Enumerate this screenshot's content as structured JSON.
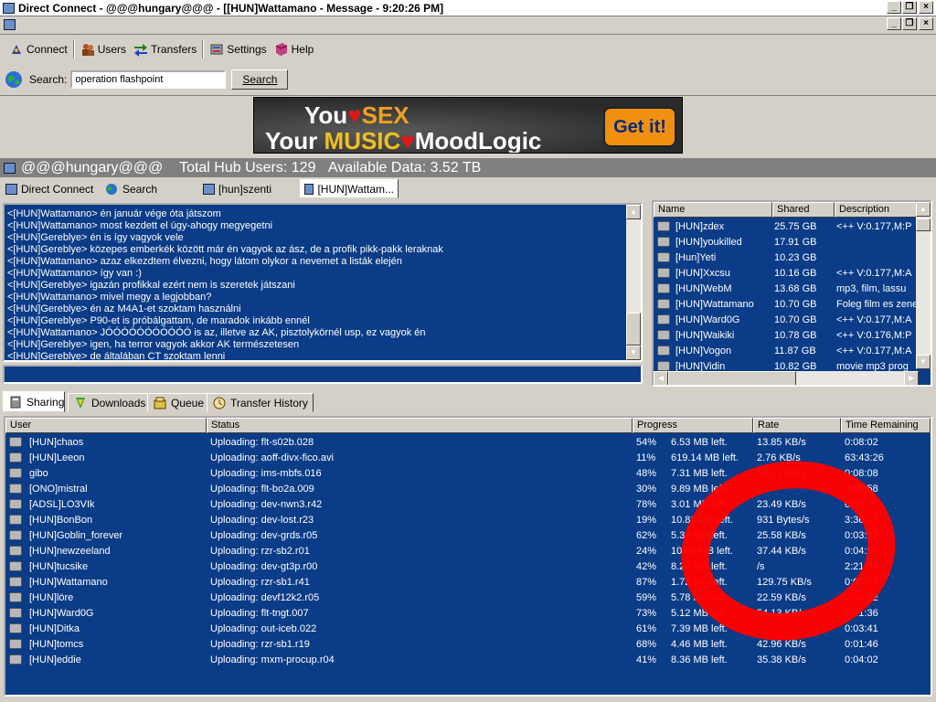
{
  "window": {
    "title": "Direct Connect - @@@hungary@@@ - [[HUN]Wattamano - Message - 9:20:26 PM]"
  },
  "toolbar": {
    "connect": "Connect",
    "users": "Users",
    "transfers": "Transfers",
    "settings": "Settings",
    "help": "Help"
  },
  "search": {
    "label": "Search:",
    "value": "operation flashpoint",
    "button": "Search"
  },
  "banner": {
    "line1_a": "You",
    "line1_b": "SEX",
    "line2_a": "Your",
    "line2_b": "MUSIC",
    "line2_c": "MoodLogic",
    "cta": "Get it!"
  },
  "hub": {
    "name": "@@@hungary@@@",
    "total_users": "Total Hub Users: 129",
    "available": "Available Data: 3.52 TB"
  },
  "tabs": [
    {
      "label": "Direct Connect"
    },
    {
      "label": "Search"
    },
    {
      "label": "[hun]szenti"
    },
    {
      "label": "[HUN]Wattam..."
    }
  ],
  "chat": [
    "<[HUN]Wattamano> én január vége óta játszom",
    "<[HUN]Wattamano> most kezdett el úgy-ahogy megyegetni",
    "<[HUN]Gereblye> én is így vagyok vele",
    "<[HUN]Gereblye> közepes emberkék között már én vagyok az ász, de a profik pikk-pakk leraknak",
    "<[HUN]Wattamano> azaz elkezdtem élvezni, hogy látom olykor a nevemet a listák elején",
    "<[HUN]Wattamano> így van :)",
    "<[HUN]Gereblye> igazán profikkal ezért nem is szeretek játszani",
    "<[HUN]Wattamano> mivel megy a legjobban?",
    "<[HUN]Gereblye> én az M4A1-et szoktam használni",
    "<[HUN]Gereblye> P90-et is próbálgattam, de maradok inkább ennél",
    "<[HUN]Wattamano> JÓÓÓÓÓÓÓÓÓÓÓ is az, illetve az AK, pisztolykörnél usp, ez vagyok én",
    "<[HUN]Gereblye> igen, ha terror vagyok akkor AK természetesen",
    "<[HUN]Gereblye> de általában CT szoktam lenni"
  ],
  "userlist": {
    "headers": [
      "Name",
      "Shared",
      "Description"
    ],
    "rows": [
      {
        "name": "[HUN]zdex",
        "shared": "25.75 GB",
        "desc": "<++ V:0.177,M:P"
      },
      {
        "name": "[HUN]youkilled",
        "shared": "17.91 GB",
        "desc": ""
      },
      {
        "name": "[Hun]Yeti",
        "shared": "10.23 GB",
        "desc": ""
      },
      {
        "name": "[HUN]Xxcsu",
        "shared": "10.16 GB",
        "desc": "<++ V:0.177,M:A"
      },
      {
        "name": "[HUN]WebM",
        "shared": "13.68 GB",
        "desc": "mp3, film, lassu"
      },
      {
        "name": "[HUN]Wattamano",
        "shared": "10.70 GB",
        "desc": "Foleg film es zene"
      },
      {
        "name": "[HUN]Ward0G",
        "shared": "10.70 GB",
        "desc": "<++ V:0.177,M:A"
      },
      {
        "name": "[HUN]Waikiki",
        "shared": "10.78 GB",
        "desc": "<++ V:0.176,M:P"
      },
      {
        "name": "[HUN]Vogon",
        "shared": "11.87 GB",
        "desc": "<++ V:0.177,M:A"
      },
      {
        "name": "[HUN]Vidin",
        "shared": "10.82 GB",
        "desc": "movie mp3 prog"
      }
    ]
  },
  "bottom_tabs": [
    {
      "label": "Sharing"
    },
    {
      "label": "Downloads"
    },
    {
      "label": "Queue"
    },
    {
      "label": "Transfer History"
    }
  ],
  "transfers": {
    "headers": [
      "User",
      "Status",
      "Progress",
      "",
      "Rate",
      "Time Remaining"
    ],
    "rows": [
      {
        "user": "[HUN]chaos",
        "status": "Uploading: flt-s02b.028",
        "pct": "54%",
        "left": "6.53 MB left.",
        "rate": "13.85 KB/s",
        "time": "0:08:02"
      },
      {
        "user": "[HUN]Leeon",
        "status": "Uploading: aoff-divx-fico.avi",
        "pct": "11%",
        "left": "619.14 MB left.",
        "rate": "2.76 KB/s",
        "time": "63:43:26"
      },
      {
        "user": "gibo",
        "status": "Uploading: ims-mbfs.016",
        "pct": "48%",
        "left": "7.31 MB left.",
        "rate": "15.31 KB/s",
        "time": "0:08:08"
      },
      {
        "user": "[ONO]mistral",
        "status": "Uploading: flt-bo2a.009",
        "pct": "30%",
        "left": "9.89 MB left.",
        "rate": "",
        "time": "0:06:58"
      },
      {
        "user": "[ADSL]LO3VIk",
        "status": "Uploading: dev-nwn3.r42",
        "pct": "78%",
        "left": "3.01 MB left.",
        "rate": "23.49 KB/s",
        "time": "0:02:11"
      },
      {
        "user": "[HUN]BonBon",
        "status": "Uploading: dev-lost.r23",
        "pct": "19%",
        "left": "10.81 MB left.",
        "rate": "931 Bytes/s",
        "time": "3:36:13"
      },
      {
        "user": "[HUN]Goblin_forever",
        "status": "Uploading: dev-grds.r05",
        "pct": "62%",
        "left": "5.32 MB left.",
        "rate": "25.58 KB/s",
        "time": "0:03:33"
      },
      {
        "user": "[HUN]newzeeland",
        "status": "Uploading: rzr-sb2.r01",
        "pct": "24%",
        "left": "10.83 MB left.",
        "rate": "37.44 KB/s",
        "time": "0:04:56"
      },
      {
        "user": "[HUN]tucsike",
        "status": "Uploading: dev-gt3p.r00",
        "pct": "42%",
        "left": "8.20 MB left.",
        "rate": "/s",
        "time": "2:21:54"
      },
      {
        "user": "[HUN]Wattamano",
        "status": "Uploading: rzr-sb1.r41",
        "pct": "87%",
        "left": "1.72 MB left.",
        "rate": "129.75 KB/s",
        "time": "0:00:13"
      },
      {
        "user": "[HUN]löre",
        "status": "Uploading: devf12k2.r05",
        "pct": "59%",
        "left": "5.78 MB left.",
        "rate": "22.59 KB/s",
        "time": "0:04:22"
      },
      {
        "user": "[HUN]Ward0G",
        "status": "Uploading: flt-tngt.007",
        "pct": "73%",
        "left": "5.12 MB left.",
        "rate": "54.13 KB/s",
        "time": "0:01:36"
      },
      {
        "user": "[HUN]Ditka",
        "status": "Uploading: out-iceb.022",
        "pct": "61%",
        "left": "7.39 MB left.",
        "rate": "",
        "time": "0:03:41"
      },
      {
        "user": "[HUN]tomcs",
        "status": "Uploading: rzr-sb1.r19",
        "pct": "68%",
        "left": "4.46 MB left.",
        "rate": "42.96 KB/s",
        "time": "0:01:46"
      },
      {
        "user": "[HUN]eddie",
        "status": "Uploading: mxm-procup.r04",
        "pct": "41%",
        "left": "8.36 MB left.",
        "rate": "35.38 KB/s",
        "time": "0:04:02"
      }
    ]
  },
  "colors": {
    "list_bg": "#0b3c87",
    "annotation": "#ff0000"
  }
}
